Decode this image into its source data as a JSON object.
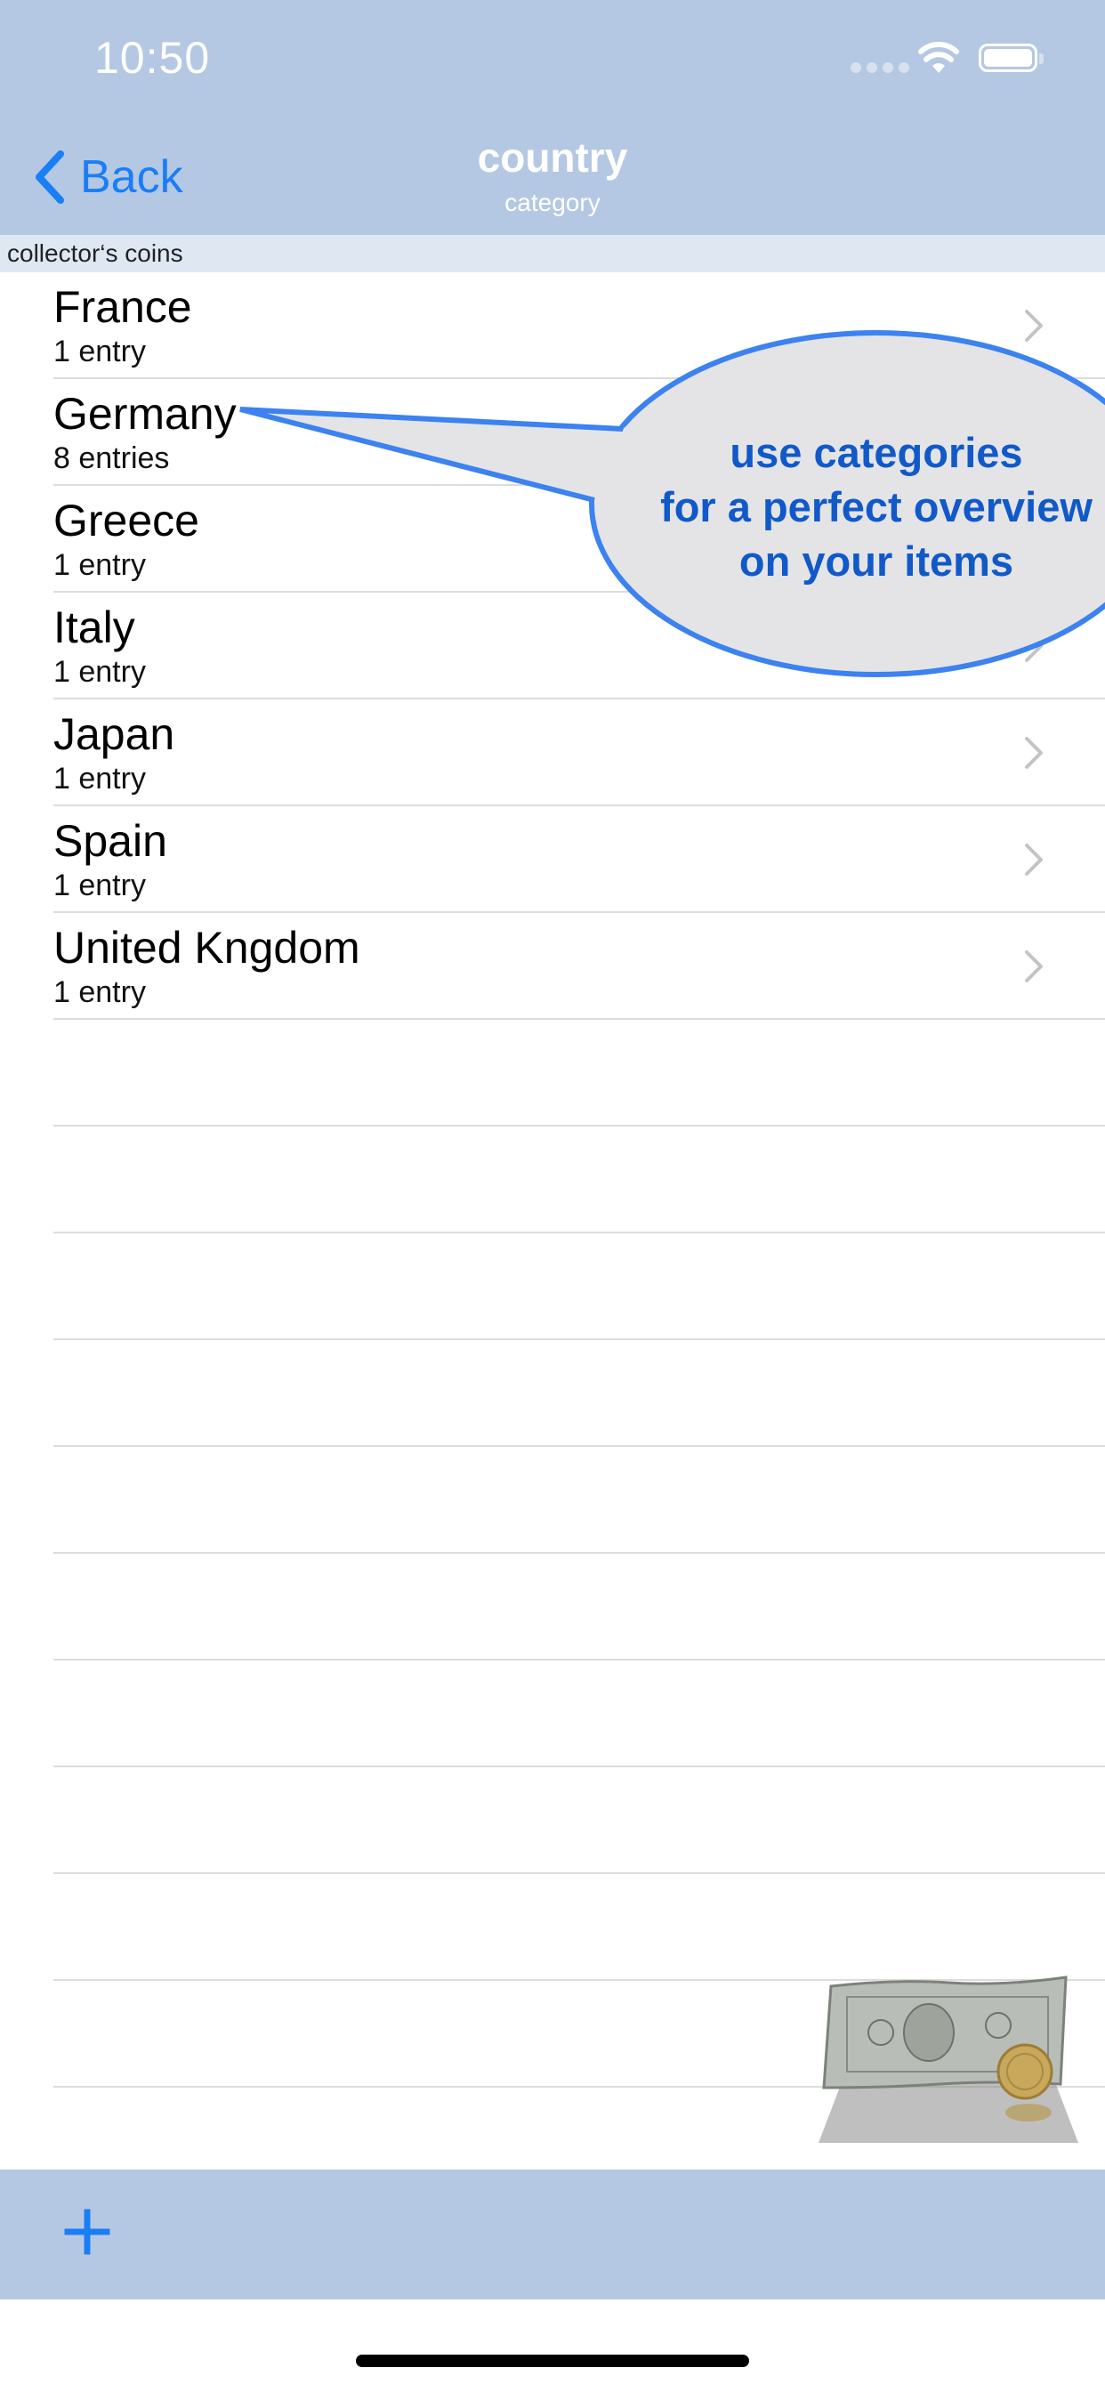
{
  "status_bar": {
    "time": "10:50",
    "icons": [
      "signal-dots-icon",
      "wifi-icon",
      "battery-icon"
    ]
  },
  "nav_bar": {
    "back_label": "Back",
    "title": "country",
    "subtitle": "category",
    "accent_color": "#1a7ef5",
    "bar_color": "#b4c8e3"
  },
  "section_header": "collector‘s coins",
  "rows": [
    {
      "title": "France",
      "subtitle": "1 entry"
    },
    {
      "title": "Germany",
      "subtitle": "8 entries"
    },
    {
      "title": "Greece",
      "subtitle": "1 entry"
    },
    {
      "title": "Italy",
      "subtitle": "1 entry"
    },
    {
      "title": "Japan",
      "subtitle": "1 entry"
    },
    {
      "title": "Spain",
      "subtitle": "1 entry"
    },
    {
      "title": "United Kngdom",
      "subtitle": "1 entry"
    }
  ],
  "callout": {
    "line1": "use categories",
    "line2": "for a perfect overview",
    "line3": "on your items",
    "text_color": "#1159c9",
    "border_color": "#3c82f0"
  },
  "toolbar": {
    "add_icon": "plus-icon"
  }
}
